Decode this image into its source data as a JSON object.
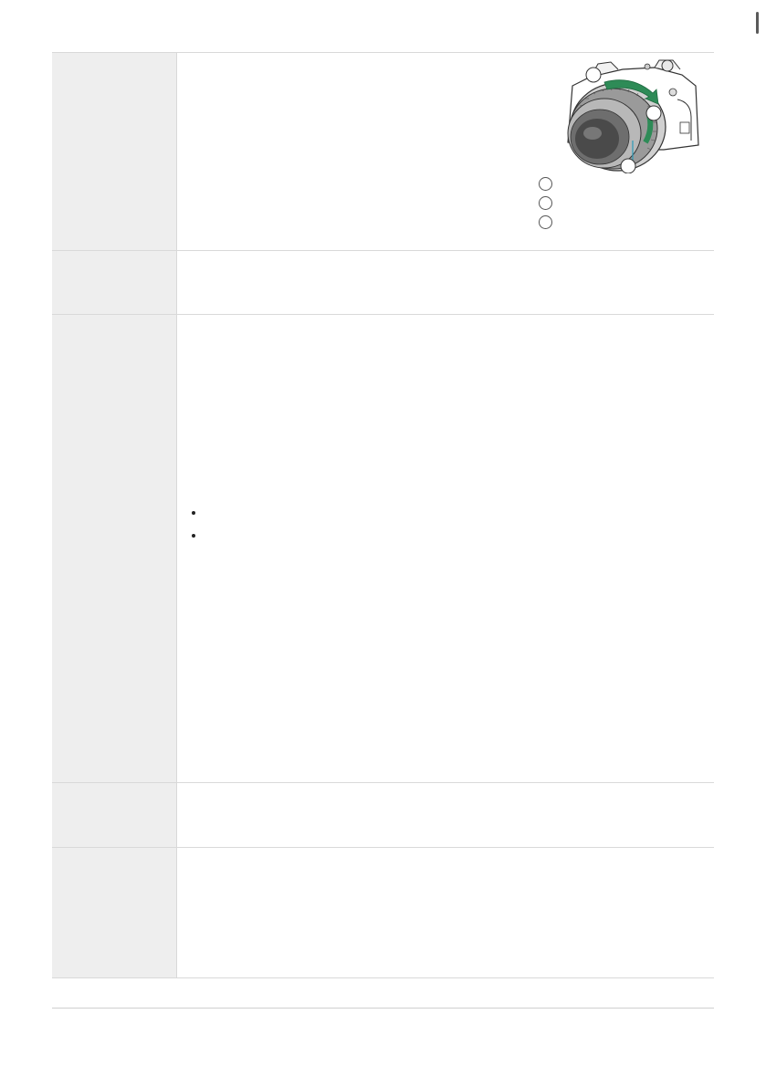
{
  "page": {
    "accent_color": "#2e8b57",
    "rule_color": "#d9d9d9",
    "label_cell_color": "#eeeeee"
  },
  "table": {
    "rows": [
      {
        "label": "",
        "text": ""
      },
      {
        "label": "",
        "text": ""
      },
      {
        "label": "",
        "text": ""
      },
      {
        "label": "",
        "text": ""
      },
      {
        "label": "",
        "text": ""
      }
    ]
  },
  "illustration": {
    "icon": "camera-lens-ring-icon",
    "callouts": [
      "",
      "",
      ""
    ]
  },
  "legend": {
    "items": [
      {
        "number": "",
        "label": ""
      },
      {
        "number": "",
        "label": ""
      },
      {
        "number": "",
        "label": ""
      }
    ]
  },
  "bullets": [
    {
      "text": ""
    },
    {
      "text": ""
    }
  ]
}
